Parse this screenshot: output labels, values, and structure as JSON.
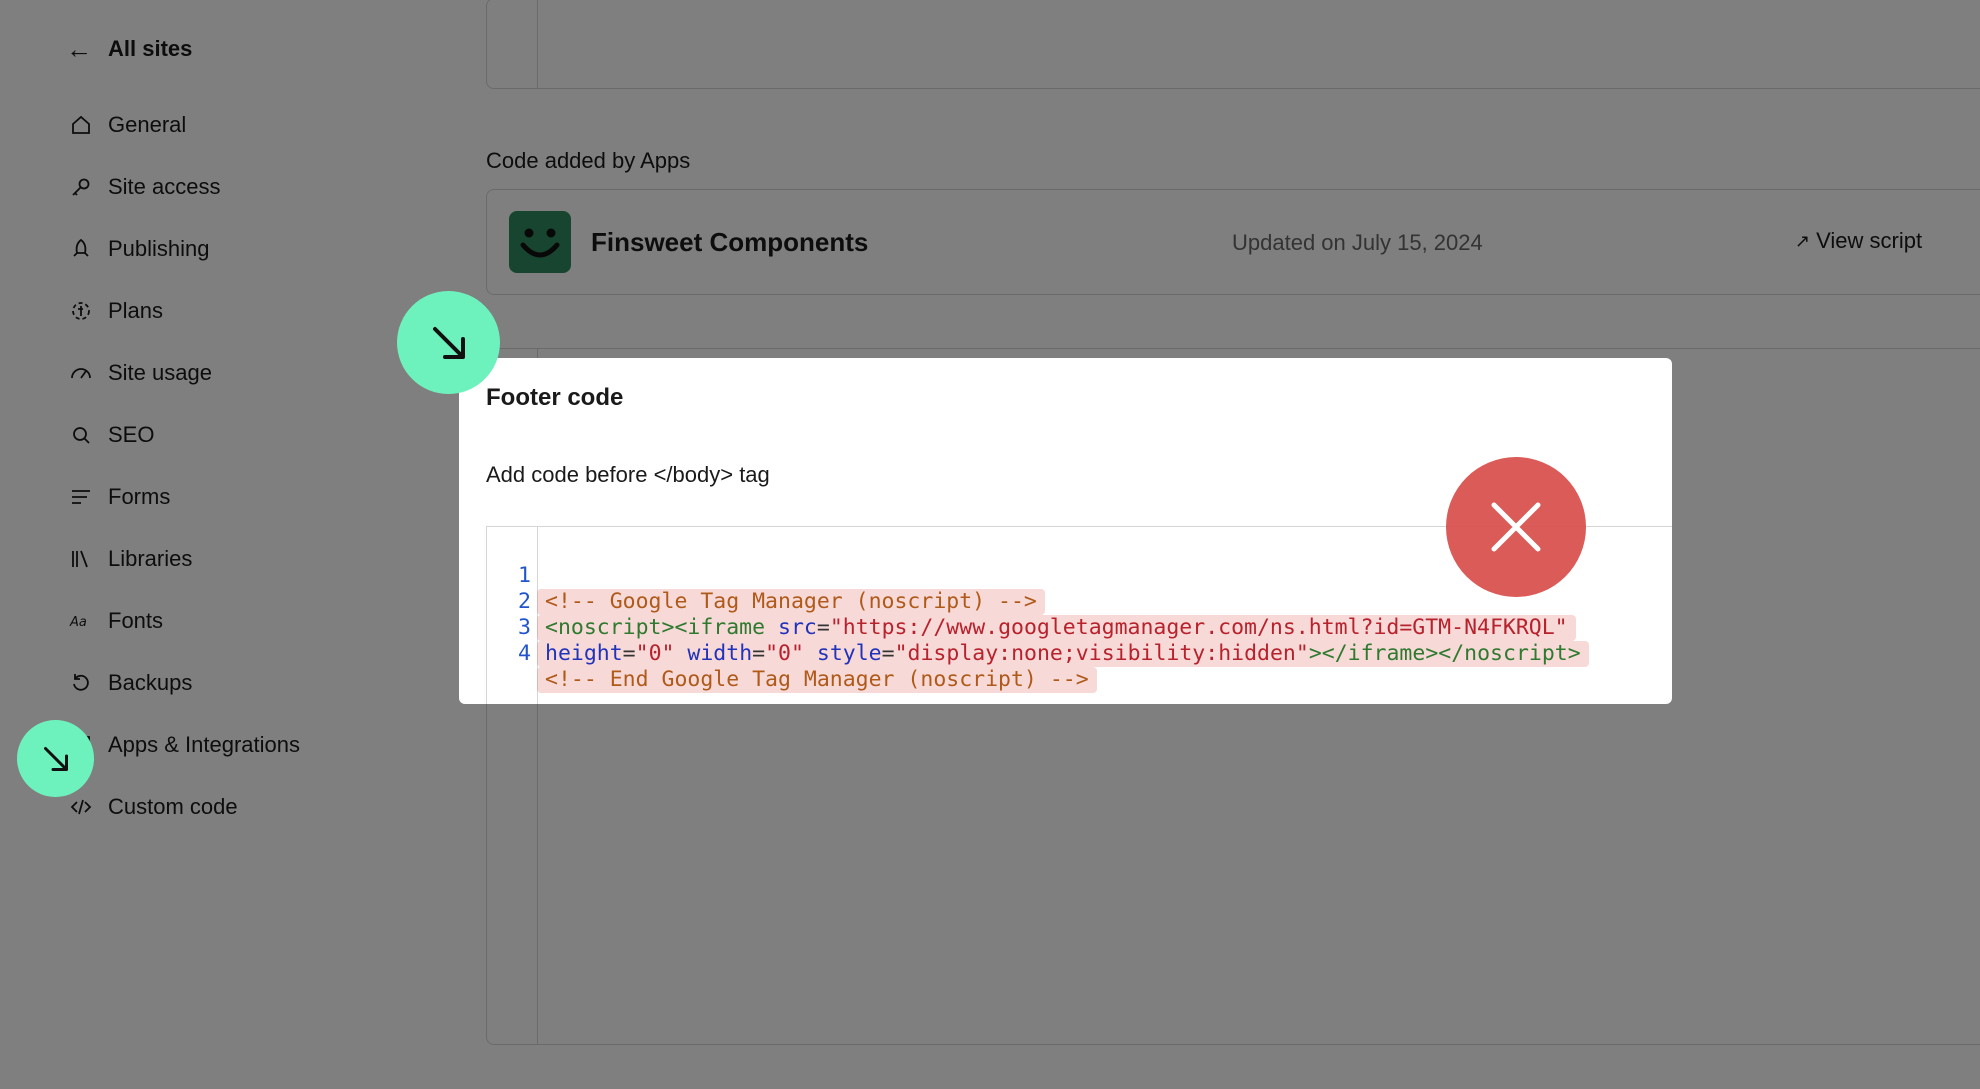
{
  "sidebar": {
    "back_label": "All sites",
    "items": [
      {
        "label": "General",
        "icon": "home-icon"
      },
      {
        "label": "Site access",
        "icon": "key-icon"
      },
      {
        "label": "Publishing",
        "icon": "rocket-icon"
      },
      {
        "label": "Plans",
        "icon": "plans-icon"
      },
      {
        "label": "Site usage",
        "icon": "gauge-icon"
      },
      {
        "label": "SEO",
        "icon": "search-icon"
      },
      {
        "label": "Forms",
        "icon": "lines-icon"
      },
      {
        "label": "Libraries",
        "icon": "books-icon"
      },
      {
        "label": "Fonts",
        "icon": "font-icon"
      },
      {
        "label": "Backups",
        "icon": "restore-icon"
      },
      {
        "label": "Apps & Integrations",
        "icon": "apps-icon"
      },
      {
        "label": "Custom code",
        "icon": "code-icon",
        "active": true
      }
    ]
  },
  "main": {
    "apps_section_title": "Code added by Apps",
    "app": {
      "name": "Finsweet Components",
      "updated": "Updated on July 15, 2024",
      "view_label": "View script",
      "logo_color": "#2f8a5e"
    }
  },
  "modal": {
    "title": "Footer code",
    "description": "Add code before </body> tag",
    "code_lines": [
      {
        "n": "1",
        "text": "<!-- Google Tag Manager (noscript) -->"
      },
      {
        "n": "2",
        "text": "<noscript><iframe src=\"https://www.googletagmanager.com/ns.html?id=GTM-N4FKRQL\""
      },
      {
        "n": "3",
        "text": "height=\"0\" width=\"0\" style=\"display:none;visibility:hidden\"></iframe></noscript>"
      },
      {
        "n": "4",
        "text": "<!-- End Google Tag Manager (noscript) -->"
      }
    ]
  },
  "colors": {
    "marker_green": "#6ef2bd",
    "marker_red": "#d9534f",
    "highlight": "#d9534f"
  }
}
